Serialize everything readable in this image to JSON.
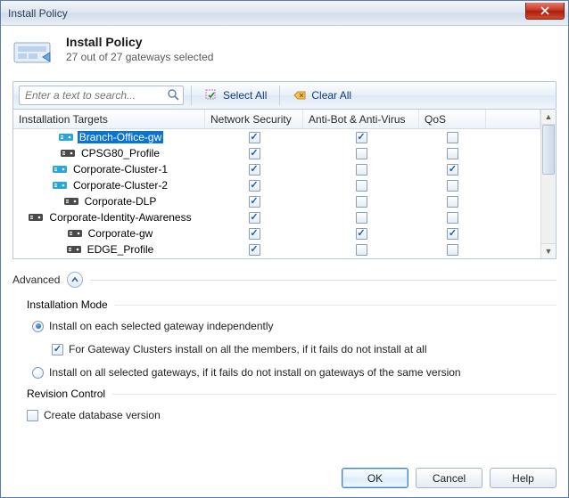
{
  "window": {
    "title": "Install Policy"
  },
  "header": {
    "title": "Install Policy",
    "subtitle": "27 out of 27 gateways selected"
  },
  "toolbar": {
    "search_placeholder": "Enter a text to search...",
    "select_all": "Select All",
    "clear_all": "Clear All"
  },
  "columns": {
    "targets": "Installation Targets",
    "network_security": "Network Security",
    "antibot": "Anti-Bot & Anti-Virus",
    "qos": "QoS"
  },
  "rows": [
    {
      "name": "Branch-Office-gw",
      "selected": true,
      "icon": "gw-blue",
      "net": true,
      "av": true,
      "qos": false
    },
    {
      "name": "CPSG80_Profile",
      "selected": false,
      "icon": "gw-dark",
      "net": true,
      "av": false,
      "qos": false
    },
    {
      "name": "Corporate-Cluster-1",
      "selected": false,
      "icon": "gw-blue",
      "net": true,
      "av": false,
      "qos": true
    },
    {
      "name": "Corporate-Cluster-2",
      "selected": false,
      "icon": "gw-blue",
      "net": true,
      "av": false,
      "qos": false
    },
    {
      "name": "Corporate-DLP",
      "selected": false,
      "icon": "gw-dark",
      "net": true,
      "av": false,
      "qos": false
    },
    {
      "name": "Corporate-Identity-Awareness",
      "selected": false,
      "icon": "gw-dark",
      "net": true,
      "av": false,
      "qos": false
    },
    {
      "name": "Corporate-gw",
      "selected": false,
      "icon": "gw-dark",
      "net": true,
      "av": true,
      "qos": true
    },
    {
      "name": "EDGE_Profile",
      "selected": false,
      "icon": "gw-dark",
      "net": true,
      "av": false,
      "qos": false
    }
  ],
  "advanced": {
    "label": "Advanced",
    "install_mode_label": "Installation Mode",
    "opt_each": "Install on each selected gateway independently",
    "opt_cluster": "For Gateway Clusters install on all the members, if it fails do not install at all",
    "opt_all": "Install on all selected gateways, if it fails do not install on gateways of the same version",
    "revision_label": "Revision Control",
    "opt_revision": "Create database version"
  },
  "buttons": {
    "ok": "OK",
    "cancel": "Cancel",
    "help": "Help"
  }
}
